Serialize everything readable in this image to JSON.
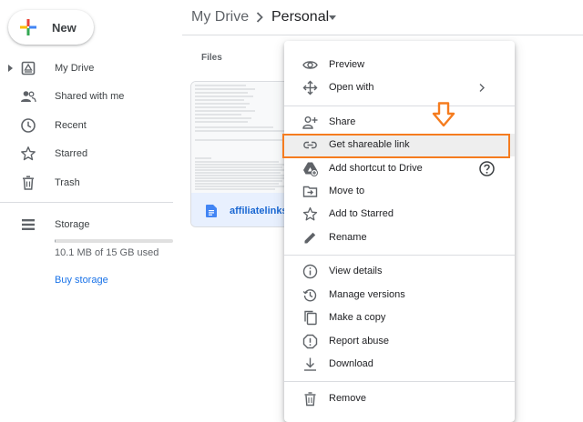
{
  "sidebar": {
    "new_label": "New",
    "items": [
      {
        "label": "My Drive",
        "icon": "my-drive-icon"
      },
      {
        "label": "Shared with me",
        "icon": "shared-people-icon"
      },
      {
        "label": "Recent",
        "icon": "clock-icon"
      },
      {
        "label": "Starred",
        "icon": "star-icon"
      },
      {
        "label": "Trash",
        "icon": "trash-icon"
      }
    ],
    "storage": {
      "label": "Storage",
      "icon": "storage-icon",
      "used_text": "10.1 MB of 15 GB used",
      "used_fraction": 0.0007,
      "buy_label": "Buy storage"
    }
  },
  "breadcrumb": {
    "root": "My Drive",
    "current": "Personal"
  },
  "files": {
    "heading": "Files",
    "card": {
      "name": "affiliatelinks",
      "icon": "google-docs-icon"
    }
  },
  "context_menu": {
    "items": [
      {
        "label": "Preview",
        "icon": "eye-icon"
      },
      {
        "label": "Open with",
        "icon": "move-arrows-icon",
        "submenu": true
      },
      {
        "label": "Share",
        "icon": "add-person-icon"
      },
      {
        "label": "Get shareable link",
        "icon": "link-icon",
        "highlighted": true
      },
      {
        "label": "Add shortcut to Drive",
        "icon": "drive-shortcut-icon",
        "help": true
      },
      {
        "label": "Move to",
        "icon": "move-folder-icon"
      },
      {
        "label": "Add to Starred",
        "icon": "star-icon"
      },
      {
        "label": "Rename",
        "icon": "pencil-icon"
      },
      {
        "label": "View details",
        "icon": "info-icon"
      },
      {
        "label": "Manage versions",
        "icon": "history-icon"
      },
      {
        "label": "Make a copy",
        "icon": "copy-icon"
      },
      {
        "label": "Report abuse",
        "icon": "report-icon"
      },
      {
        "label": "Download",
        "icon": "download-icon"
      },
      {
        "label": "Remove",
        "icon": "trash-icon"
      }
    ]
  },
  "colors": {
    "accent_blue": "#1a73e8",
    "annotation_orange": "#f57c1f",
    "highlight_bg": "#eeeeee",
    "divider": "#dadce0"
  }
}
